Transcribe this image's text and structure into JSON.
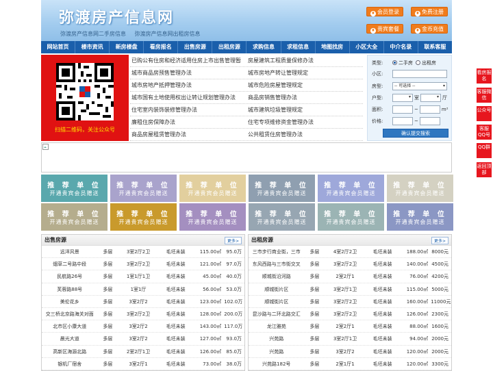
{
  "header": {
    "logo": "弥渡房产信息网",
    "taglines": [
      "弥渡房产信息网二手房信息",
      "弥渡房产信息网出租房信息"
    ],
    "buttons": [
      {
        "label": "会员登录",
        "icon": "user-icon"
      },
      {
        "label": "免费注册",
        "icon": "register-icon"
      },
      {
        "label": "贵宾套餐",
        "icon": "vip-icon"
      },
      {
        "label": "金币充值",
        "icon": "coin-icon"
      }
    ]
  },
  "nav": [
    "网站首页",
    "楼市资讯",
    "新房楼盘",
    "看房报名",
    "出售房源",
    "出租房源",
    "求购信息",
    "求租信息",
    "地图找房",
    "小区大全",
    "中介名录",
    "联系客服"
  ],
  "qr": {
    "caption": "扫描二维码，关注公众号"
  },
  "links": [
    [
      "已购公有住房和经济适用住房上市出售管理暂",
      "房屋建筑工程质量保修办法"
    ],
    [
      "城市商品房预售管理办法",
      "城市房地产转让管理规定"
    ],
    [
      "城市房地产抵押管理办法",
      "城市危险房屋管理规定"
    ],
    [
      "城市国有土地使用权出让转让规划管理办法",
      "商品房销售管理办法"
    ],
    [
      "住宅室内装饰装修管理办法",
      "城市建筑垃圾管理规定"
    ],
    [
      "廉租住房保障办法",
      "住宅专项维修资金管理办法"
    ],
    [
      "商品房屋租赁管理办法",
      "公共租赁住房管理办法"
    ]
  ],
  "search": {
    "type_label": "类型:",
    "type_options": [
      "二手房",
      "出租房"
    ],
    "community_label": "小区:",
    "housetype_label": "房型:",
    "housetype_value": "-- 可选择 --",
    "layout_label": "户型:",
    "room_label": "室",
    "hall_label": "厅",
    "area_label": "面积:",
    "area_unit": "m²",
    "price_label": "价格:",
    "submit": "确认提交搜索"
  },
  "ads": {
    "line1": "推 荐 单 位",
    "line2": "开通贵宾会员赠送",
    "colors": [
      "#5aa8ad",
      "#a9a3cc",
      "#e2cf9e",
      "#8f9fb0",
      "#9ea8da",
      "#d4d1c2",
      "#b5ad8d",
      "#c99a2c",
      "#a48fc0",
      "#97a6b2",
      "#9bb4b4",
      "#8b97c4"
    ]
  },
  "sale": {
    "title": "出售房源",
    "more": "更多>",
    "rows": [
      [
        "远洋风景",
        "多层",
        "3室2厅2卫",
        "毛坯未装",
        "115.00㎡",
        "95.0万"
      ],
      [
        "烟草二号路中段",
        "多层",
        "3室2厅2卫",
        "毛坯未装",
        "121.00㎡",
        "97.0万"
      ],
      [
        "民航路26号",
        "多层",
        "1室1厅1卫",
        "毛坯未装",
        "45.00㎡",
        "40.0万"
      ],
      [
        "芙蓉路88号",
        "多层",
        "1室1厅",
        "毛坯未装",
        "56.00㎡",
        "53.0万"
      ],
      [
        "美伦花乡",
        "多层",
        "3室2厅2",
        "毛坯未装",
        "123.00㎡",
        "102.0万"
      ],
      [
        "交三桥北京路海关对面",
        "多层",
        "3室2厅2卫",
        "毛坯未装",
        "128.00㎡",
        "200.0万"
      ],
      [
        "北市区小康大道",
        "多层",
        "3室2厅2",
        "毛坯未装",
        "143.00㎡",
        "117.0万"
      ],
      [
        "晨光大道",
        "多层",
        "3室2厅2",
        "毛坯未装",
        "127.00㎡",
        "93.0万"
      ],
      [
        "高新区海源北路",
        "多层",
        "2室2厅1卫",
        "毛坯未装",
        "126.00㎡",
        "85.0万"
      ],
      [
        "银机厂宿舍",
        "多层",
        "3室2厅1",
        "毛坯未装",
        "73.00㎡",
        "38.0万"
      ]
    ]
  },
  "rent": {
    "title": "出租房源",
    "more": "更多>",
    "rows": [
      [
        "三市步行商业街，三市",
        "多层",
        "4室2厅2卫",
        "毛坯未装",
        "188.00㎡",
        "8000元"
      ],
      [
        "东风西路与三市街交叉",
        "多层",
        "3室2厅2卫",
        "毛坯未装",
        "140.00㎡",
        "4500元"
      ],
      [
        "顺城街沿河路",
        "多层",
        "2室2厅1",
        "毛坯未装",
        "76.00㎡",
        "4200元"
      ],
      [
        "顺城街片区",
        "多层",
        "3室2厅1卫",
        "毛坯未装",
        "115.00㎡",
        "5000元"
      ],
      [
        "顺城街片区",
        "多层",
        "3室2厅2卫",
        "毛坯未装",
        "160.00㎡",
        "11000元"
      ],
      [
        "昆沙路与二环北路交汇",
        "多层",
        "3室2厅2卫",
        "毛坯未装",
        "126.00㎡",
        "2300元"
      ],
      [
        "龙江雅苑",
        "多层",
        "2室2厅1",
        "毛坯未装",
        "88.00㎡",
        "1600元"
      ],
      [
        "兴苑路",
        "多层",
        "3室2厅1卫",
        "毛坯未装",
        "94.00㎡",
        "2000元"
      ],
      [
        "兴苑路",
        "多层",
        "3室2厅2",
        "毛坯未装",
        "120.00㎡",
        "2000元"
      ],
      [
        "兴苑路182号",
        "多层",
        "2室1厅1",
        "毛坯未装",
        "120.00㎡",
        "3300元"
      ]
    ]
  },
  "side": [
    "看房报名",
    "客服微信",
    "公众号",
    "客服QQ号",
    "QQ群",
    "返回顶部"
  ]
}
